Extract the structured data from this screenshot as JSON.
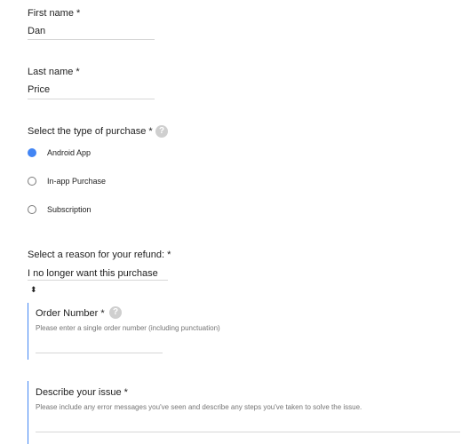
{
  "form": {
    "first_name": {
      "label": "First name *",
      "value": "Dan"
    },
    "last_name": {
      "label": "Last name *",
      "value": "Price"
    },
    "purchase_type": {
      "label": "Select the type of purchase *",
      "help_icon": "question-mark",
      "options": [
        {
          "label": "Android App",
          "selected": true
        },
        {
          "label": "In-app Purchase",
          "selected": false
        },
        {
          "label": "Subscription",
          "selected": false
        }
      ]
    },
    "refund_reason": {
      "label": "Select a reason for your refund: *",
      "selected": "I no longer want this purchase",
      "arrow": "⬍"
    },
    "order_number": {
      "label": "Order Number *",
      "help_icon": "question-mark",
      "hint": "Please enter a single order number (including punctuation)",
      "value": ""
    },
    "issue": {
      "label": "Describe your issue *",
      "hint": "Please include any error messages you've seen and describe any steps you've taken to solve the issue.",
      "value": ""
    }
  },
  "colors": {
    "accent": "#4285f4",
    "help_icon_bg": "#cfcfcf",
    "hint_text": "#757575",
    "underline": "#d6d6d6"
  }
}
